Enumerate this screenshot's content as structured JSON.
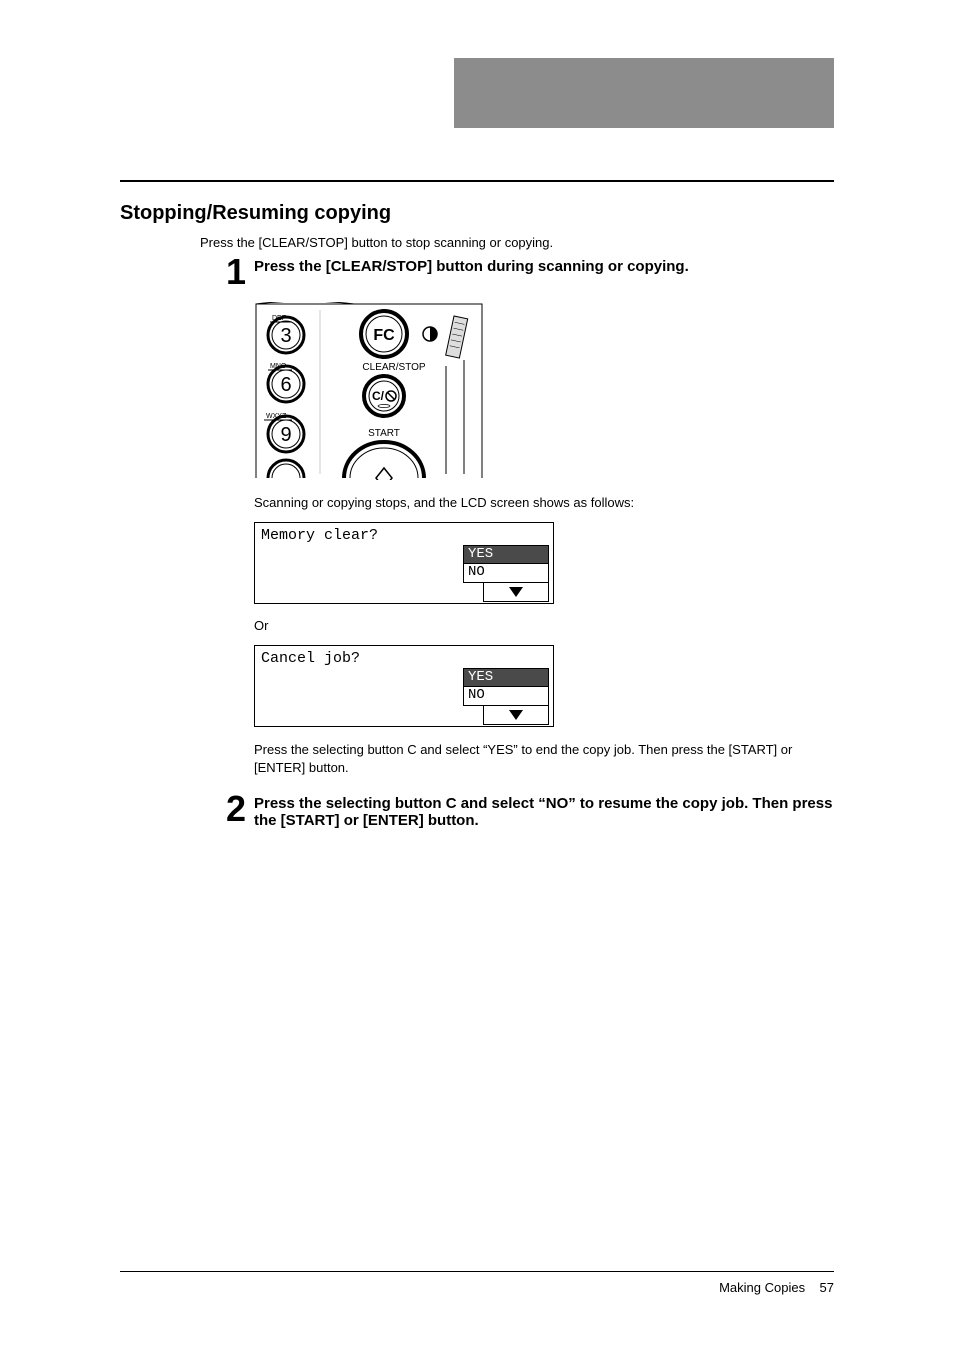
{
  "section_title": "Stopping/Resuming copying",
  "intro": "Press the [CLEAR/STOP] button to stop scanning or copying.",
  "step1": {
    "num": "1",
    "title": "Press the [CLEAR/STOP] button during scanning or copying."
  },
  "panel": {
    "key_3_sub": "DEF",
    "key_3": "3",
    "key_6_sub": "MNO",
    "key_6": "6",
    "key_9_sub": "WXYZ",
    "key_9": "9",
    "fc": "FC",
    "clear_stop": "CLEAR/STOP",
    "clear_icon": "C/",
    "start": "START"
  },
  "caption_after_panel": "Scanning or copying stops, and the LCD screen shows as follows:",
  "lcd1": {
    "line": "Memory clear?",
    "opt_yes": "YES",
    "opt_no": "NO"
  },
  "or": "Or",
  "lcd2": {
    "line": "Cancel job?",
    "opt_yes": "YES",
    "opt_no": "NO"
  },
  "post_para": "Press the selecting button C and select “YES” to end the copy job. Then press the [START] or [ENTER] button.",
  "step2": {
    "num": "2",
    "title": "Press the selecting button C and select “NO” to resume the copy job. Then press the [START] or [ENTER] button."
  },
  "footer": {
    "label": "Making Copies",
    "page": "57"
  }
}
